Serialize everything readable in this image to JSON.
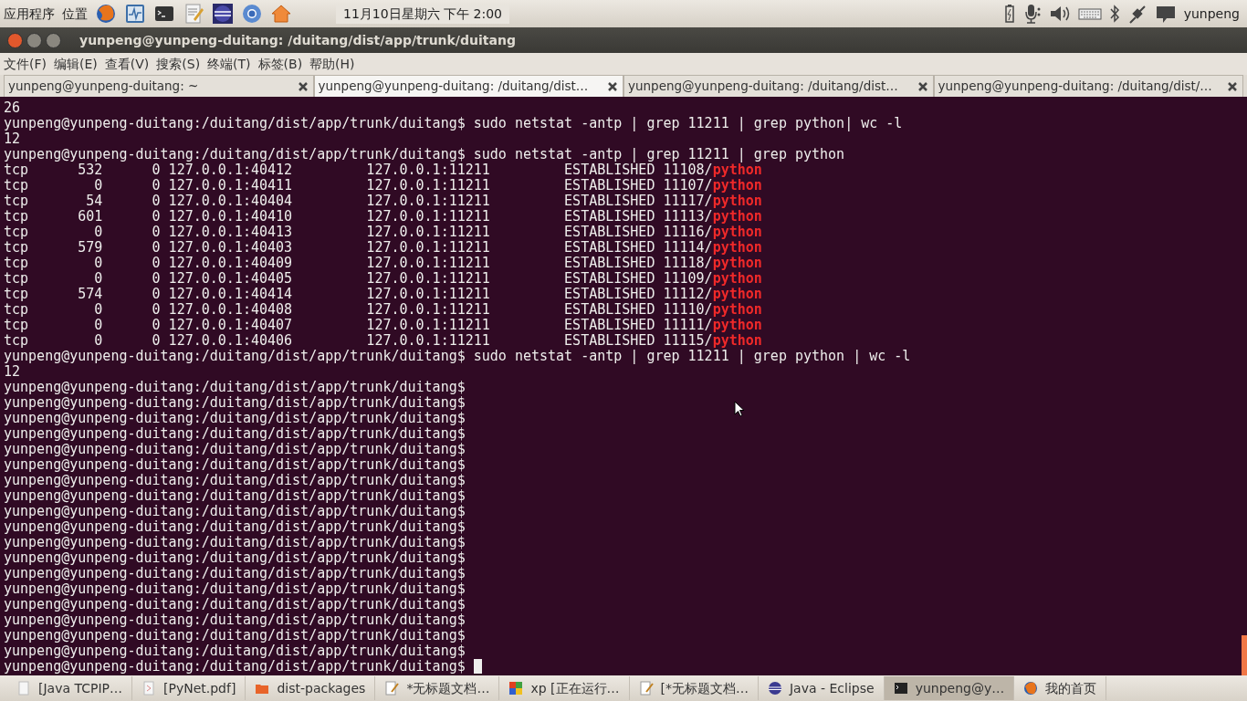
{
  "top_panel": {
    "menus": [
      "应用程序",
      "位置"
    ],
    "clock": "11月10日星期六 下午 2:00",
    "user": "yunpeng"
  },
  "window": {
    "title": "yunpeng@yunpeng-duitang: /duitang/dist/app/trunk/duitang"
  },
  "menu_bar": [
    "文件(F)",
    "编辑(E)",
    "查看(V)",
    "搜索(S)",
    "终端(T)",
    "标签(B)",
    "帮助(H)"
  ],
  "tabs": [
    {
      "label": "yunpeng@yunpeng-duitang: ~",
      "selected": false
    },
    {
      "label": "yunpeng@yunpeng-duitang: /duitang/dist…",
      "selected": true
    },
    {
      "label": "yunpeng@yunpeng-duitang: /duitang/dist…",
      "selected": false
    },
    {
      "label": "yunpeng@yunpeng-duitang: /duitang/dist/…",
      "selected": false
    }
  ],
  "terminal": {
    "lines": [
      {
        "text": "26"
      },
      {
        "text": "yunpeng@yunpeng-duitang:/duitang/dist/app/trunk/duitang$ sudo netstat -antp | grep 11211 | grep python| wc -l"
      },
      {
        "text": "12"
      },
      {
        "text": "yunpeng@yunpeng-duitang:/duitang/dist/app/trunk/duitang$ sudo netstat -antp | grep 11211 | grep python"
      },
      {
        "text": "tcp      532      0 127.0.0.1:40412         127.0.0.1:11211         ESTABLISHED 11108/",
        "highlight": "python"
      },
      {
        "text": "tcp        0      0 127.0.0.1:40411         127.0.0.1:11211         ESTABLISHED 11107/",
        "highlight": "python"
      },
      {
        "text": "tcp       54      0 127.0.0.1:40404         127.0.0.1:11211         ESTABLISHED 11117/",
        "highlight": "python"
      },
      {
        "text": "tcp      601      0 127.0.0.1:40410         127.0.0.1:11211         ESTABLISHED 11113/",
        "highlight": "python"
      },
      {
        "text": "tcp        0      0 127.0.0.1:40413         127.0.0.1:11211         ESTABLISHED 11116/",
        "highlight": "python"
      },
      {
        "text": "tcp      579      0 127.0.0.1:40403         127.0.0.1:11211         ESTABLISHED 11114/",
        "highlight": "python"
      },
      {
        "text": "tcp        0      0 127.0.0.1:40409         127.0.0.1:11211         ESTABLISHED 11118/",
        "highlight": "python"
      },
      {
        "text": "tcp        0      0 127.0.0.1:40405         127.0.0.1:11211         ESTABLISHED 11109/",
        "highlight": "python"
      },
      {
        "text": "tcp      574      0 127.0.0.1:40414         127.0.0.1:11211         ESTABLISHED 11112/",
        "highlight": "python"
      },
      {
        "text": "tcp        0      0 127.0.0.1:40408         127.0.0.1:11211         ESTABLISHED 11110/",
        "highlight": "python"
      },
      {
        "text": "tcp        0      0 127.0.0.1:40407         127.0.0.1:11211         ESTABLISHED 11111/",
        "highlight": "python"
      },
      {
        "text": "tcp        0      0 127.0.0.1:40406         127.0.0.1:11211         ESTABLISHED 11115/",
        "highlight": "python"
      },
      {
        "text": "yunpeng@yunpeng-duitang:/duitang/dist/app/trunk/duitang$ sudo netstat -antp | grep 11211 | grep python | wc -l"
      },
      {
        "text": "12"
      },
      {
        "text": "yunpeng@yunpeng-duitang:/duitang/dist/app/trunk/duitang$"
      },
      {
        "text": "yunpeng@yunpeng-duitang:/duitang/dist/app/trunk/duitang$"
      },
      {
        "text": "yunpeng@yunpeng-duitang:/duitang/dist/app/trunk/duitang$"
      },
      {
        "text": "yunpeng@yunpeng-duitang:/duitang/dist/app/trunk/duitang$"
      },
      {
        "text": "yunpeng@yunpeng-duitang:/duitang/dist/app/trunk/duitang$"
      },
      {
        "text": "yunpeng@yunpeng-duitang:/duitang/dist/app/trunk/duitang$"
      },
      {
        "text": "yunpeng@yunpeng-duitang:/duitang/dist/app/trunk/duitang$"
      },
      {
        "text": "yunpeng@yunpeng-duitang:/duitang/dist/app/trunk/duitang$"
      },
      {
        "text": "yunpeng@yunpeng-duitang:/duitang/dist/app/trunk/duitang$"
      },
      {
        "text": "yunpeng@yunpeng-duitang:/duitang/dist/app/trunk/duitang$"
      },
      {
        "text": "yunpeng@yunpeng-duitang:/duitang/dist/app/trunk/duitang$"
      },
      {
        "text": "yunpeng@yunpeng-duitang:/duitang/dist/app/trunk/duitang$"
      },
      {
        "text": "yunpeng@yunpeng-duitang:/duitang/dist/app/trunk/duitang$"
      },
      {
        "text": "yunpeng@yunpeng-duitang:/duitang/dist/app/trunk/duitang$"
      },
      {
        "text": "yunpeng@yunpeng-duitang:/duitang/dist/app/trunk/duitang$"
      },
      {
        "text": "yunpeng@yunpeng-duitang:/duitang/dist/app/trunk/duitang$"
      },
      {
        "text": "yunpeng@yunpeng-duitang:/duitang/dist/app/trunk/duitang$"
      },
      {
        "text": "yunpeng@yunpeng-duitang:/duitang/dist/app/trunk/duitang$"
      },
      {
        "text": "yunpeng@yunpeng-duitang:/duitang/dist/app/trunk/duitang$",
        "cursor": true
      }
    ]
  },
  "taskbar": [
    {
      "label": "[Java TCPIP…",
      "selected": false
    },
    {
      "label": "[PyNet.pdf]",
      "selected": false
    },
    {
      "label": "dist-packages",
      "selected": false
    },
    {
      "label": "*无标题文档…",
      "selected": false
    },
    {
      "label": "xp [正在运行…",
      "selected": false
    },
    {
      "label": "[*无标题文档…",
      "selected": false
    },
    {
      "label": "Java - Eclipse",
      "selected": false
    },
    {
      "label": "yunpeng@y…",
      "selected": true
    },
    {
      "label": "我的首页",
      "selected": false
    }
  ]
}
